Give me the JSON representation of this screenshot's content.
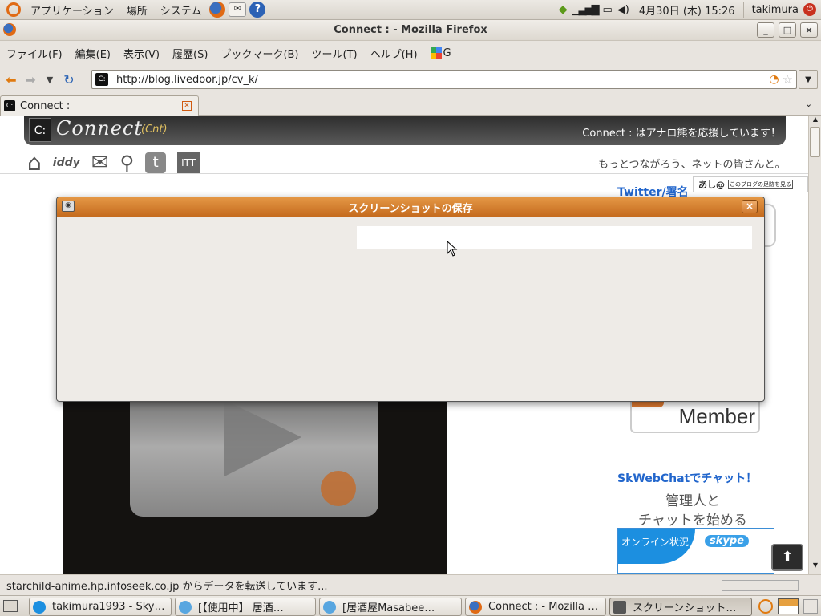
{
  "top_panel": {
    "menus": [
      "アプリケーション",
      "場所",
      "システム"
    ],
    "datetime": "4月30日 (木) 15:26",
    "user": "takimura"
  },
  "window": {
    "title": "Connect : - Mozilla Firefox",
    "min": "_",
    "max": "□",
    "close": "×"
  },
  "menubar": {
    "items": [
      "ファイル(F)",
      "編集(E)",
      "表示(V)",
      "履歴(S)",
      "ブックマーク(B)",
      "ツール(T)",
      "ヘルプ(H)"
    ],
    "google": "G"
  },
  "navbar": {
    "url": "http://blog.livedoor.jp/cv_k/"
  },
  "tab": {
    "label": "Connect :"
  },
  "page": {
    "logo_text": "Connect",
    "logo_sub": "(Cnt)",
    "header_right": "Connect : はアナロ熊を応援しています！",
    "tagline": "もっとつながろう、ネットの皆さんと。",
    "nav_iddy": "iddy",
    "ashi_label": "あし@",
    "ashi_sub": "このブログの足跡を見る",
    "twitter_label": "Twitter/署名",
    "member_label": "Member",
    "skype_title": "SkWebChatでチャット！",
    "skype_line1": "管理人と",
    "skype_line2": "チャットを始める",
    "skype_badge": "オンライン状況",
    "skype_logo": "skype"
  },
  "dialog": {
    "title": "スクリーンショットの保存",
    "close": "×"
  },
  "statusbar": {
    "text": "starchild-anime.hp.infoseek.co.jp からデータを転送しています..."
  },
  "taskbar": {
    "items": [
      "takimura1993 - Sky…",
      "[【使用中】 居酒…",
      "[居酒屋Masabee…",
      "Connect : - Mozilla …",
      "スクリーンショット…"
    ]
  },
  "colors": {
    "accent": "#e07a10",
    "dialog_title": "#d5802d",
    "link_blue": "#2266cc",
    "header_dark": "#3a3a3a"
  },
  "icons": [
    "ubuntu-icon",
    "firefox-icon",
    "mail-icon",
    "help-icon",
    "back-icon",
    "forward-icon",
    "reload-icon",
    "rss-icon",
    "star-icon",
    "home-icon",
    "mail-nav-icon",
    "search-nav-icon",
    "twitter-nav-icon",
    "camera-icon",
    "play-icon"
  ]
}
